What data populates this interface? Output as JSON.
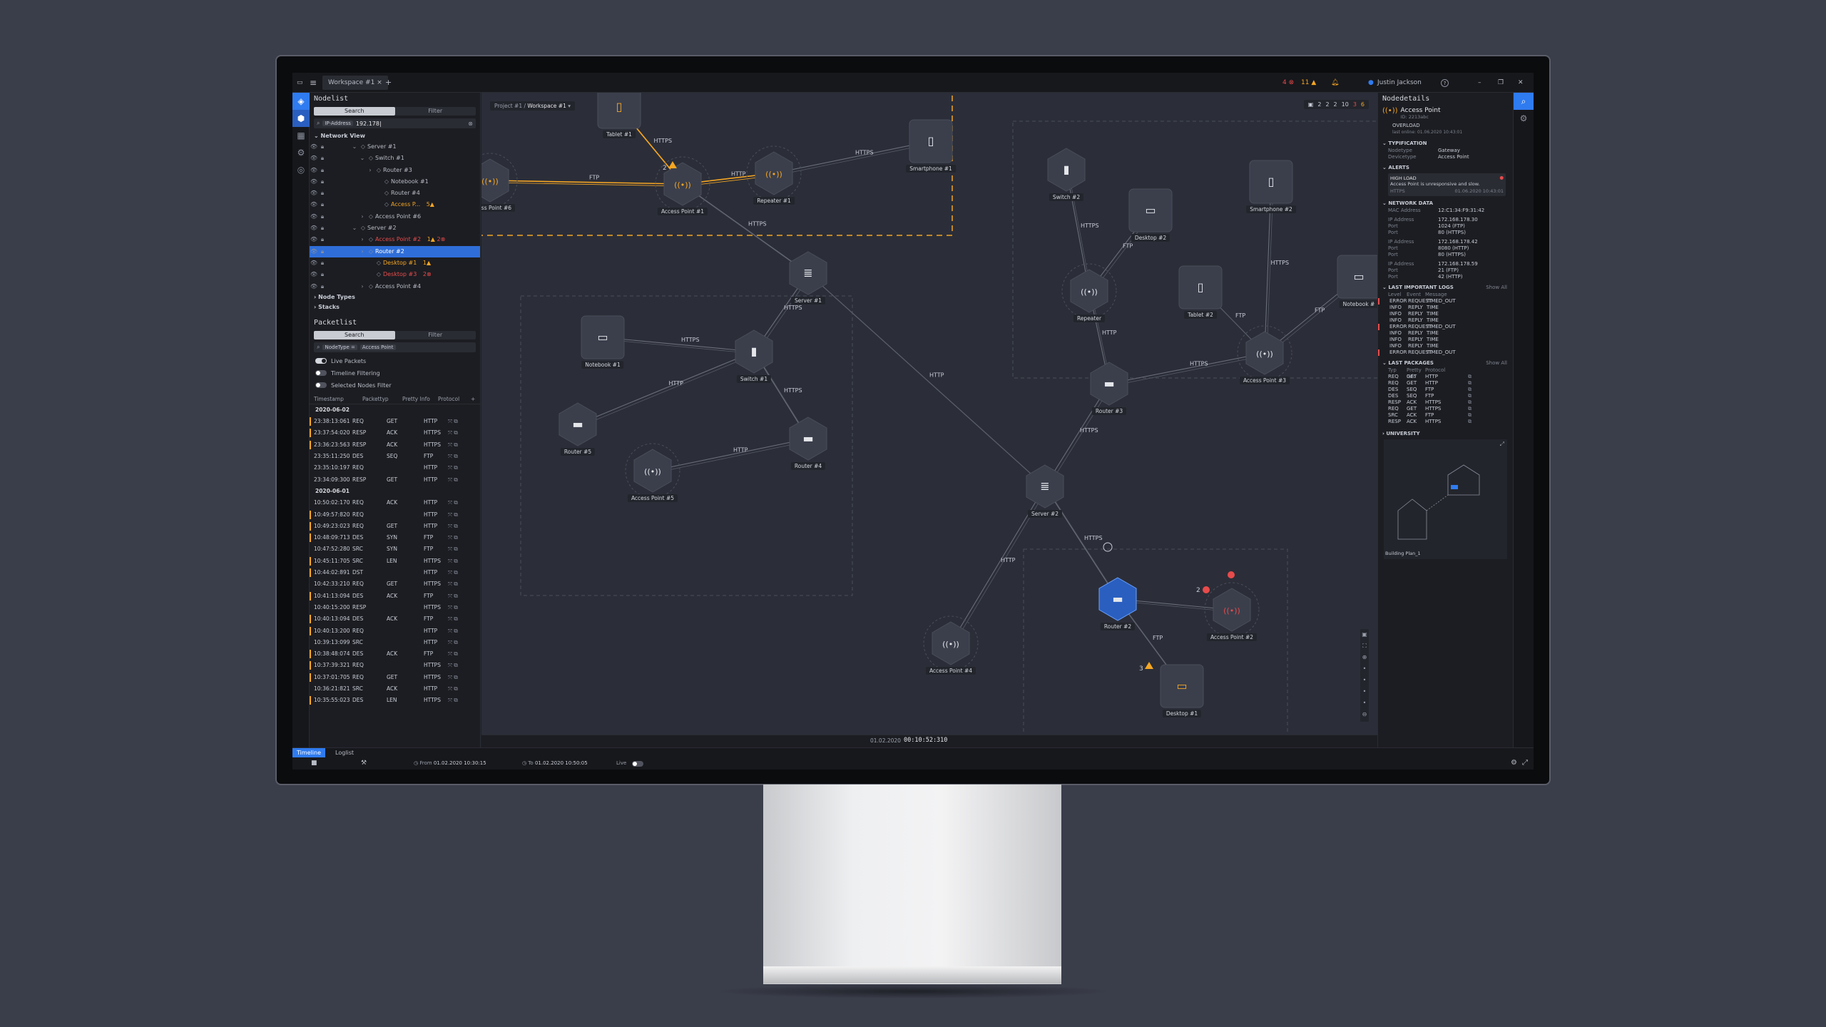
{
  "titlebar": {
    "workspace_tab": "Workspace #1",
    "close_tab": "×",
    "new_tab": "+",
    "alert_err_count": "4",
    "alert_warn_count": "11",
    "user": "Justin Jackson",
    "help": "?"
  },
  "nodelist": {
    "title": "Nodelist",
    "search_label": "Search",
    "filter_label": "Filter",
    "search_chip": "IP-Address",
    "search_value": "192.178|",
    "network_view": "Network View",
    "tree": [
      {
        "label": "Server #1",
        "indent": 3,
        "expand": "v"
      },
      {
        "label": "Switch #1",
        "indent": 4,
        "expand": "v"
      },
      {
        "label": "Router #3",
        "indent": 5,
        "expand": ">"
      },
      {
        "label": "Notebook #1",
        "indent": 6,
        "expand": ""
      },
      {
        "label": "Router #4",
        "indent": 6,
        "expand": ""
      },
      {
        "label": "Access P...",
        "indent": 6,
        "expand": "",
        "status": "warn",
        "count": "5"
      },
      {
        "label": "Access Point #6",
        "indent": 4,
        "expand": ">"
      },
      {
        "label": "Server #2",
        "indent": 3,
        "expand": "v"
      },
      {
        "label": "Access Point #2",
        "indent": 4,
        "expand": ">",
        "status": "both",
        "count": "1",
        "count2": "2"
      },
      {
        "label": "Router #2",
        "indent": 4,
        "expand": ">",
        "selected": true
      },
      {
        "label": "Desktop #1",
        "indent": 5,
        "expand": "",
        "status": "warn",
        "count": "1"
      },
      {
        "label": "Desktop #3",
        "indent": 5,
        "expand": "",
        "status": "err",
        "count": "2"
      },
      {
        "label": "Access Point #4",
        "indent": 4,
        "expand": ">"
      }
    ],
    "node_types": "Node Types",
    "stacks": "Stacks"
  },
  "packetlist": {
    "title": "Packetlist",
    "search_label": "Search",
    "filter_label": "Filter",
    "chip1": "NodeType =",
    "chip2": "Access Point",
    "toggles": [
      {
        "label": "Live Packets",
        "on": true
      },
      {
        "label": "Timeline Filtering",
        "on": false
      },
      {
        "label": "Selected Nodes Filter",
        "on": false
      }
    ],
    "columns": [
      "Timestamp",
      "Packettyp",
      "Pretty Info",
      "Protocol",
      "+"
    ],
    "groups": [
      {
        "date": "2020-06-02",
        "rows": [
          [
            "23:38:13:061",
            "REQ",
            "GET",
            "HTTP"
          ],
          [
            "23:37:54:020",
            "RESP",
            "ACK",
            "HTTPS"
          ],
          [
            "23:36:23:563",
            "RESP",
            "ACK",
            "HTTPS"
          ],
          [
            "23:35:11:250",
            "DES",
            "SEQ",
            "FTP"
          ],
          [
            "23:35:10:197",
            "REQ",
            "",
            "HTTP"
          ],
          [
            "23:34:09:300",
            "RESP",
            "GET",
            "HTTP"
          ]
        ]
      },
      {
        "date": "2020-06-01",
        "rows": [
          [
            "10:50:02:170",
            "REQ",
            "ACK",
            "HTTP"
          ],
          [
            "10:49:57:820",
            "REQ",
            "",
            "HTTP"
          ],
          [
            "10:49:23:023",
            "REQ",
            "GET",
            "HTTP"
          ],
          [
            "10:48:09:713",
            "DES",
            "SYN",
            "FTP"
          ],
          [
            "10:47:52:280",
            "SRC",
            "SYN",
            "FTP"
          ],
          [
            "10:45:11:705",
            "SRC",
            "LEN",
            "HTTPS"
          ],
          [
            "10:44:02:891",
            "DST",
            "",
            "HTTP"
          ],
          [
            "10:42:33:210",
            "REQ",
            "GET",
            "HTTPS"
          ],
          [
            "10:41:13:094",
            "DES",
            "ACK",
            "FTP"
          ],
          [
            "10:40:15:200",
            "RESP",
            "",
            "HTTPS"
          ],
          [
            "10:40:13:094",
            "DES",
            "ACK",
            "FTP"
          ],
          [
            "10:40:13:200",
            "REQ",
            "",
            "HTTP"
          ],
          [
            "10:39:13:099",
            "SRC",
            "",
            "HTTP"
          ],
          [
            "10:38:48:074",
            "DES",
            "ACK",
            "FTP"
          ],
          [
            "10:37:39:321",
            "REQ",
            "",
            "HTTPS"
          ],
          [
            "10:37:01:705",
            "REQ",
            "GET",
            "HTTPS"
          ],
          [
            "10:36:21:821",
            "SRC",
            "ACK",
            "HTTP"
          ],
          [
            "10:35:55:023",
            "DES",
            "LEN",
            "HTTPS"
          ]
        ]
      }
    ]
  },
  "canvas": {
    "breadcrumb_project": "Project #1 /",
    "breadcrumb_workspace": "Workspace #1",
    "status": {
      "a": "2",
      "b": "2",
      "c": "2",
      "d": "10",
      "e": "3",
      "f": "6"
    },
    "timestamp_date": "01.02.2020",
    "timestamp_time": "00:10:52:310",
    "nodes": [
      {
        "id": "tablet1",
        "label": "Tablet #1",
        "icon": "tablet",
        "status": "warn"
      },
      {
        "id": "smartphone1",
        "label": "Smartphone #1",
        "icon": "phone"
      },
      {
        "id": "ap6",
        "label": "Access Point #6",
        "icon": "ap",
        "status": "warn"
      },
      {
        "id": "ap1",
        "label": "Access Point #1",
        "icon": "ap",
        "status": "warn"
      },
      {
        "id": "rep1",
        "label": "Repeater #1",
        "icon": "ap",
        "status": "warn"
      },
      {
        "id": "server1",
        "label": "Server #1",
        "icon": "server"
      },
      {
        "id": "notebook1",
        "label": "Notebook #1",
        "icon": "laptop"
      },
      {
        "id": "switch1",
        "label": "Switch #1",
        "icon": "switch"
      },
      {
        "id": "router5",
        "label": "Router #5",
        "icon": "router"
      },
      {
        "id": "router4",
        "label": "Router #4",
        "icon": "router"
      },
      {
        "id": "ap5",
        "label": "Access Point #5",
        "icon": "ap"
      },
      {
        "id": "switch2",
        "label": "Switch #2",
        "icon": "switch"
      },
      {
        "id": "desktop2",
        "label": "Desktop #2",
        "icon": "desktop"
      },
      {
        "id": "smartphone2",
        "label": "Smartphone #2",
        "icon": "phone"
      },
      {
        "id": "repeater",
        "label": "Repeater",
        "icon": "ap"
      },
      {
        "id": "tablet2",
        "label": "Tablet #2",
        "icon": "tablet"
      },
      {
        "id": "notebook",
        "label": "Notebook #",
        "icon": "laptop"
      },
      {
        "id": "router3",
        "label": "Router #3",
        "icon": "router"
      },
      {
        "id": "ap3",
        "label": "Access Point #3",
        "icon": "ap"
      },
      {
        "id": "server2",
        "label": "Server #2",
        "icon": "server"
      },
      {
        "id": "router2",
        "label": "Router #2",
        "icon": "router",
        "selected": true
      },
      {
        "id": "ap2",
        "label": "Access Point #2",
        "icon": "ap",
        "status": "err"
      },
      {
        "id": "ap4",
        "label": "Access Point #4",
        "icon": "ap"
      },
      {
        "id": "desktop1",
        "label": "Desktop #1",
        "icon": "desktop",
        "status": "warn"
      }
    ],
    "edge_labels": [
      "HTTPS",
      "HTTP",
      "FTP",
      "HTTPS",
      "HTTPS",
      "HTTP",
      "HTTPS",
      "HTTP",
      "HTTP",
      "HTTPS",
      "HTTP",
      "HTTP",
      "HTTP",
      "FTP",
      "HTTPS",
      "FTP",
      "FTP",
      "HTTPS",
      "HTTPS",
      "FTP",
      "HTTPS",
      "HTTP",
      "FTP",
      "FTP",
      "FTP",
      "HTTPS"
    ],
    "badges": {
      "tablet_count": "2",
      "ap_count": "3",
      "ap2_count": "2"
    }
  },
  "timeline": {
    "tab_timeline": "Timeline",
    "tab_loglist": "Loglist",
    "from_label": "From",
    "from_value": "01.02.2020  10:30:15",
    "to_label": "To",
    "to_value": "01.02.2020  10:50:05",
    "live": "Live"
  },
  "details": {
    "title": "Nodedetails",
    "node_type_name": "Access Point",
    "node_id": "ID: 2213abc",
    "overload": "OVERLOAD",
    "overload_sub": "last online: 01.06.2020     10:43:01",
    "typification": "TYPIFICATION",
    "nodetype_k": "Nodetype",
    "nodetype_v": "Gateway",
    "devicetype_k": "Devicetype",
    "devicetype_v": "Access Point",
    "alerts": "ALERTS",
    "alert_title": "HIGH LOAD",
    "alert_text": "Access Point is unresponsive and slow.",
    "alert_proto": "HTTPS",
    "alert_time": "01.06.2020  10:43:01",
    "network": "NETWORK DATA",
    "network_rows": [
      [
        "MAC Address",
        "12:C1:34:F9:31:42"
      ],
      [
        "IP Address",
        "172.168.178.30"
      ],
      [
        "Port",
        "1024  (FTP)"
      ],
      [
        "Port",
        "80    (HTTPS)"
      ],
      [
        "IP Address",
        "172.168.178.42"
      ],
      [
        "Port",
        "8080  (HTTP)"
      ],
      [
        "Port",
        "80    (HTTPS)"
      ],
      [
        "IP Address",
        "172.168.178.59"
      ],
      [
        "Port",
        "21    (FTP)"
      ],
      [
        "Port",
        "42    (HTTP)"
      ]
    ],
    "logs": "LAST IMPORTANT LOGS",
    "show_all": "Show All",
    "log_cols": [
      "Level",
      "Event",
      "Message"
    ],
    "log_rows": [
      [
        "ERROR",
        "REQUEST",
        "TIMED_OUT"
      ],
      [
        "INFO",
        "REPLY",
        "TIME"
      ],
      [
        "INFO",
        "REPLY",
        "TIME"
      ],
      [
        "INFO",
        "REPLY",
        "TIME"
      ],
      [
        "ERROR",
        "REQUEST",
        "TIMED_OUT"
      ],
      [
        "INFO",
        "REPLY",
        "TIME"
      ],
      [
        "INFO",
        "REPLY",
        "TIME"
      ],
      [
        "INFO",
        "REPLY",
        "TIME"
      ],
      [
        "ERROR",
        "REQUEST",
        "TIMED_OUT"
      ]
    ],
    "packages": "LAST PACKAGES",
    "show_all2": "Show All",
    "pkg_cols": [
      "Typ",
      "Pretty Info",
      "Protocol"
    ],
    "pkg_rows": [
      [
        "REQ",
        "GET",
        "HTTP"
      ],
      [
        "REQ",
        "GET",
        "HTTP"
      ],
      [
        "DES",
        "SEQ",
        "FTP"
      ],
      [
        "DES",
        "SEQ",
        "FTP"
      ],
      [
        "RESP",
        "ACK",
        "HTTPS"
      ],
      [
        "REQ",
        "GET",
        "HTTPS"
      ],
      [
        "SRC",
        "ACK",
        "FTP"
      ],
      [
        "RESP",
        "ACK",
        "HTTPS"
      ]
    ],
    "university": "UNIVERSITY",
    "building": "Building Plan_1"
  },
  "colors": {
    "accent": "#2f7bf0",
    "warn": "#f5a623",
    "error": "#e84b4b",
    "canvas": "#2b2e38",
    "node": "#3b3f4c"
  }
}
